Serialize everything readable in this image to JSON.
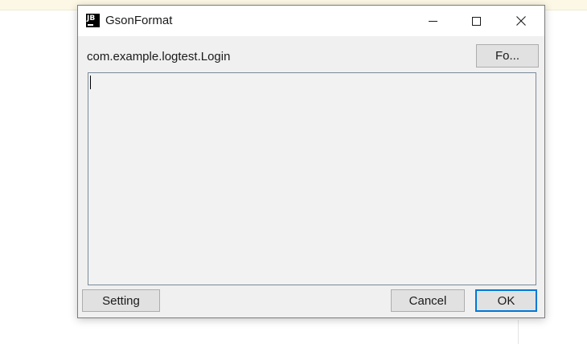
{
  "window": {
    "title": "GsonFormat",
    "icon_text": "JB",
    "controls": [
      "minimize-icon",
      "maximize-icon",
      "close-icon"
    ]
  },
  "dialog": {
    "class_name": "com.example.logtest.Login",
    "format_button": "Fo...",
    "json_input": {
      "value": "",
      "placeholder": ""
    },
    "setting_button": "Setting",
    "cancel_button": "Cancel",
    "ok_button": "OK"
  },
  "colors": {
    "focus_border": "#0078d7",
    "dialog_background": "#f0f0f0",
    "titlebar_background": "#ffffff",
    "button_background": "#e1e1e1"
  }
}
